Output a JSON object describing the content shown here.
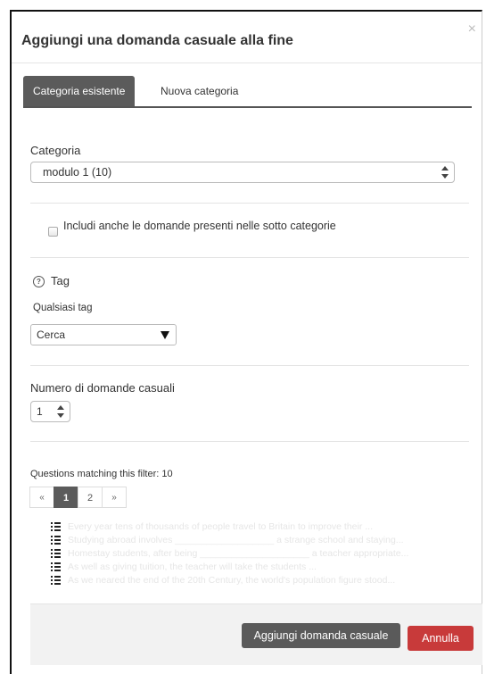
{
  "dialog": {
    "title": "Aggiungi una domanda casuale alla fine",
    "close_symbol": "×"
  },
  "tabs": [
    {
      "label": "Categoria esistente",
      "active": true
    },
    {
      "label": "Nuova categoria",
      "active": false
    }
  ],
  "category": {
    "label": "Categoria",
    "selected": "modulo 1 (10)"
  },
  "subcategories": {
    "label": "Includi anche le domande presenti nelle sotto categorie",
    "checked": false
  },
  "tags": {
    "label": "Tag",
    "help_icon": "question-circle-icon",
    "any_label": "Qualsiasi tag",
    "search_value": "Cerca"
  },
  "random_count": {
    "label": "Numero di domande casuali",
    "selected": "1"
  },
  "matching": {
    "summary": "Questions matching this filter: 10",
    "pagination": {
      "prev": "«",
      "pages": [
        "1",
        "2"
      ],
      "current": "1",
      "next": "»"
    },
    "questions": [
      "Every year tens of thousands of people travel to Britain to improve their ...",
      "Studying abroad involves ___________________ a strange school and staying...",
      "Homestay students, after being _____________________ a teacher appropriate...",
      "As well as giving tuition, the teacher will take the students ...",
      "As we neared the end of the 20th Century, the world's population figure stood..."
    ]
  },
  "buttons": {
    "add": "Aggiungi domanda casuale",
    "cancel": "Annulla"
  },
  "colors": {
    "tab_active": "#5b5b5b",
    "button_primary": "#5a5a5a",
    "button_cancel": "#c83a3a",
    "footer_bg": "#f2f2f2"
  }
}
